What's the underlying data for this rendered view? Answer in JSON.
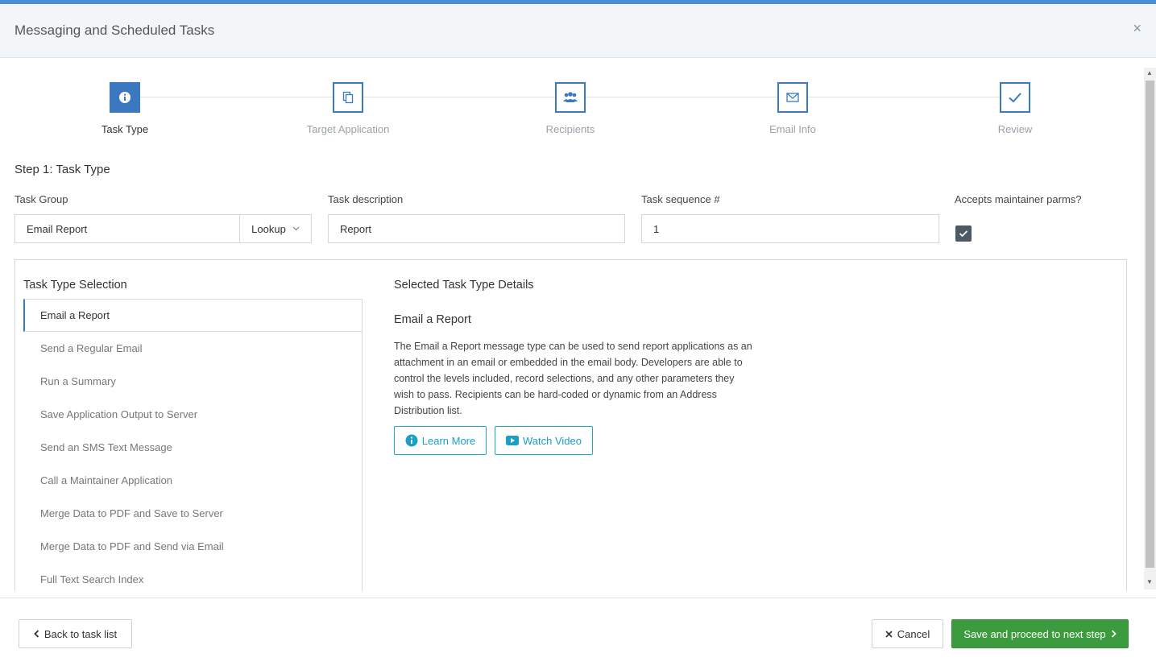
{
  "window": {
    "title": "Messaging and Scheduled Tasks",
    "close_glyph": "×"
  },
  "colors": {
    "accent": "#3a79c0",
    "topbar": "#4a90d9",
    "teal": "#1a9fc6",
    "success": "#3c9b3f"
  },
  "stepper": {
    "steps": [
      {
        "label": "Task Type",
        "icon": "info-icon",
        "active": true
      },
      {
        "label": "Target Application",
        "icon": "copy-icon",
        "active": false
      },
      {
        "label": "Recipients",
        "icon": "users-icon",
        "active": false
      },
      {
        "label": "Email Info",
        "icon": "envelope-icon",
        "active": false
      },
      {
        "label": "Review",
        "icon": "checkmark-icon",
        "active": false
      }
    ]
  },
  "form": {
    "heading": "Step 1: Task Type",
    "task_group": {
      "label": "Task Group",
      "value": "Email Report",
      "lookup_label": "Lookup"
    },
    "task_description": {
      "label": "Task description",
      "value": "Report"
    },
    "task_sequence": {
      "label": "Task sequence #",
      "value": "1"
    },
    "accepts_parms": {
      "label": "Accepts maintainer parms?",
      "checked": true
    }
  },
  "task_selection": {
    "title": "Task Type Selection",
    "items": [
      "Email a Report",
      "Send a Regular Email",
      "Run a Summary",
      "Save Application Output to Server",
      "Send an SMS Text Message",
      "Call a Maintainer Application",
      "Merge Data to PDF and Save to Server",
      "Merge Data to PDF and Send via Email",
      "Full Text Search Index"
    ],
    "selected_index": 0
  },
  "details": {
    "title": "Selected Task Type Details",
    "name": "Email a Report",
    "description": "The Email a Report message type can be used to send report applications as an attachment in an email or embedded in the email body. Developers are able to control the levels included, record selections, and any other parameters they wish to pass. Recipients can be hard-coded or dynamic from an Address Distribution list.",
    "learn_more_label": "Learn More",
    "watch_video_label": "Watch Video"
  },
  "footer": {
    "back_label": "Back to task list",
    "cancel_label": "Cancel",
    "save_label": "Save and proceed to next step"
  }
}
